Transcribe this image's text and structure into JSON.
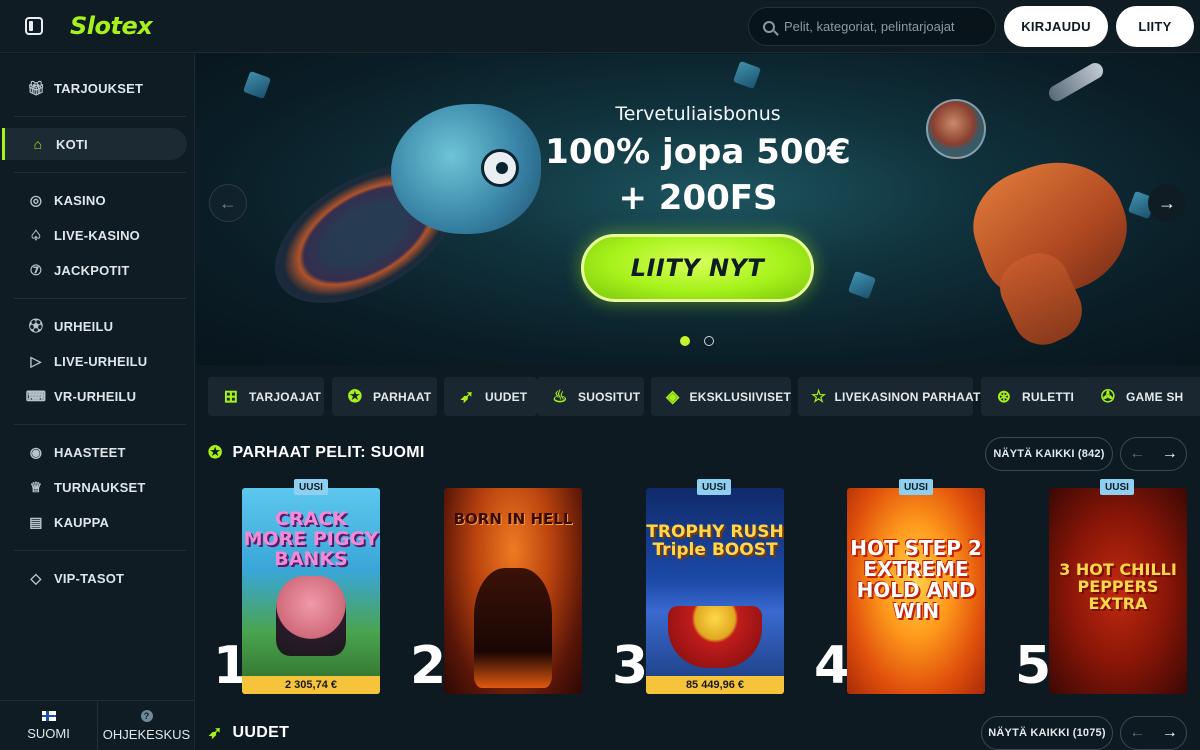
{
  "header": {
    "logo": "Slotex",
    "search_placeholder": "Pelit, kategoriat, pelintarjoajat",
    "login_label": "KIRJAUDU",
    "join_label": "LIITY"
  },
  "sidebar": {
    "items": [
      {
        "label": "TARJOUKSET",
        "icon": "gift-icon"
      },
      {
        "label": "KOTI",
        "icon": "home-icon"
      },
      {
        "label": "KASINO",
        "icon": "chip-icon"
      },
      {
        "label": "LIVE-KASINO",
        "icon": "spade-icon"
      },
      {
        "label": "JACKPOTIT",
        "icon": "seven-icon"
      },
      {
        "label": "URHEILU",
        "icon": "ball-icon"
      },
      {
        "label": "LIVE-URHEILU",
        "icon": "play-icon"
      },
      {
        "label": "VR-URHEILU",
        "icon": "gamepad-icon"
      },
      {
        "label": "HAASTEET",
        "icon": "target-icon"
      },
      {
        "label": "TURNAUKSET",
        "icon": "trophy-icon"
      },
      {
        "label": "KAUPPA",
        "icon": "shop-icon"
      },
      {
        "label": "VIP-TASOT",
        "icon": "diamond-icon"
      }
    ],
    "active": "KOTI",
    "language_label": "SUOMI",
    "help_label": "OHJEKESKUS"
  },
  "banner": {
    "subtitle": "Tervetuliaisbonus",
    "title_line1": "100% jopa 500€",
    "title_line2": "+ 200FS",
    "cta_label": "LIITY NYT",
    "slides": 2,
    "active_slide": 1
  },
  "categories": [
    {
      "label": "TARJOAJAT",
      "icon": "grid-icon"
    },
    {
      "label": "PARHAAT",
      "icon": "medal-icon"
    },
    {
      "label": "UUDET",
      "icon": "rocket-icon"
    },
    {
      "label": "SUOSITUT",
      "icon": "flame-icon"
    },
    {
      "label": "EKSKLUSIIVISET",
      "icon": "diamond-icon"
    },
    {
      "label": "LIVEKASINON PARHAAT",
      "icon": "star-icon"
    },
    {
      "label": "RULETTI",
      "icon": "roulette-icon"
    },
    {
      "label": "GAME SH",
      "icon": "wheel-icon"
    }
  ],
  "sections": {
    "top": {
      "title": "PARHAAT PELIT: SUOMI",
      "show_all": "NÄYTÄ KAIKKI (842)"
    },
    "new": {
      "title": "UUDET",
      "show_all": "NÄYTÄ KAIKKI (1075)"
    }
  },
  "games": [
    {
      "rank": "1",
      "title": "CRACK MORE PIGGY BANKS",
      "badge": "UUSI",
      "jackpot": "2 305,74 €",
      "colors": [
        "#54c3e8",
        "#3a9e4a",
        "#7b3a8a"
      ]
    },
    {
      "rank": "2",
      "title": "BORN IN HELL",
      "badge": "",
      "jackpot": "",
      "colors": [
        "#e06a1c",
        "#6a1a0c",
        "#2a0a06"
      ]
    },
    {
      "rank": "3",
      "title": "TROPHY RUSH Triple BOOST",
      "badge": "UUSI",
      "jackpot": "85 449,96 €",
      "colors": [
        "#1c3d8a",
        "#2a5ab8",
        "#b01c1c"
      ]
    },
    {
      "rank": "4",
      "title": "HOT STEP 2 EXTREME HOLD AND WIN",
      "badge": "UUSI",
      "jackpot": "",
      "colors": [
        "#ffb020",
        "#e85a10",
        "#a82a08"
      ]
    },
    {
      "rank": "5",
      "title": "3 HOT CHILLI PEPPERS EXTRA",
      "badge": "UUSI",
      "jackpot": "",
      "colors": [
        "#d82a10",
        "#8a1408",
        "#4a0a04"
      ]
    }
  ],
  "accent": "#a6f21a",
  "badge_color": "#8fd0f0",
  "jackpot_color": "#f5c43b"
}
